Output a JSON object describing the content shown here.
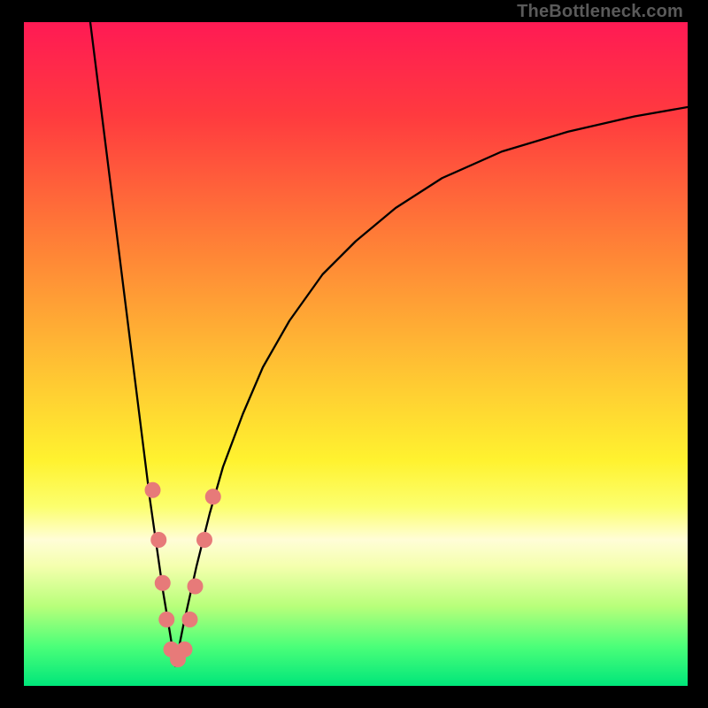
{
  "watermark": "TheBottleneck.com",
  "chart_data": {
    "type": "line",
    "title": "",
    "xlabel": "",
    "ylabel": "",
    "xlim": [
      0,
      100
    ],
    "ylim": [
      0,
      100
    ],
    "gradient_stops": [
      {
        "pct": 0,
        "color": "#ff1a54"
      },
      {
        "pct": 14,
        "color": "#ff3a3f"
      },
      {
        "pct": 32,
        "color": "#ff7b37"
      },
      {
        "pct": 52,
        "color": "#ffc233"
      },
      {
        "pct": 66,
        "color": "#fff22f"
      },
      {
        "pct": 73,
        "color": "#fcff6e"
      },
      {
        "pct": 78,
        "color": "#fffdd7"
      },
      {
        "pct": 82,
        "color": "#f4ffad"
      },
      {
        "pct": 88,
        "color": "#b8ff7a"
      },
      {
        "pct": 94,
        "color": "#4cff79"
      },
      {
        "pct": 100,
        "color": "#00e67a"
      }
    ],
    "series": [
      {
        "name": "left-branch",
        "stroke": "#000000",
        "stroke_width": 2.3,
        "x": [
          10.0,
          11.0,
          12.0,
          13.0,
          14.0,
          15.0,
          16.0,
          17.0,
          18.0,
          19.0,
          20.0,
          21.0,
          22.0,
          22.8
        ],
        "y": [
          100.0,
          92.0,
          84.0,
          76.0,
          68.0,
          60.0,
          52.0,
          44.0,
          36.0,
          28.0,
          21.0,
          14.0,
          8.0,
          3.0
        ]
      },
      {
        "name": "right-branch",
        "stroke": "#000000",
        "stroke_width": 2.3,
        "x": [
          22.8,
          24.0,
          26.0,
          28.0,
          30.0,
          33.0,
          36.0,
          40.0,
          45.0,
          50.0,
          56.0,
          63.0,
          72.0,
          82.0,
          92.0,
          100.0
        ],
        "y": [
          3.0,
          9.0,
          18.0,
          26.0,
          33.0,
          41.0,
          48.0,
          55.0,
          62.0,
          67.0,
          72.0,
          76.5,
          80.5,
          83.5,
          85.8,
          87.2
        ]
      }
    ],
    "markers": {
      "color": "#e77a79",
      "radius_px": 9,
      "points": [
        {
          "x": 19.4,
          "y": 29.5
        },
        {
          "x": 20.3,
          "y": 22.0
        },
        {
          "x": 20.9,
          "y": 15.5
        },
        {
          "x": 21.5,
          "y": 10.0
        },
        {
          "x": 22.2,
          "y": 5.5
        },
        {
          "x": 23.2,
          "y": 4.0
        },
        {
          "x": 24.2,
          "y": 5.5
        },
        {
          "x": 25.0,
          "y": 10.0
        },
        {
          "x": 25.8,
          "y": 15.0
        },
        {
          "x": 27.2,
          "y": 22.0
        },
        {
          "x": 28.5,
          "y": 28.5
        }
      ]
    }
  }
}
